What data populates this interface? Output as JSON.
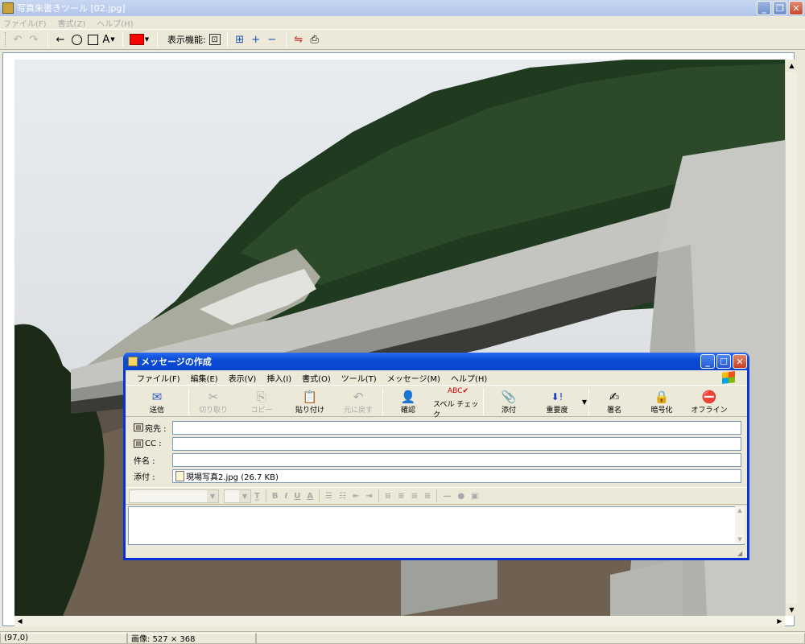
{
  "app": {
    "title": "写真朱書きツール [02.jpg]",
    "menu": [
      "ファイル(F)",
      "書式(Z)",
      "ヘルプ(H)"
    ],
    "toolbar": {
      "undo": "↶",
      "redo": "↷",
      "arrow": "←",
      "text_tool": "A",
      "color": "#ff0000",
      "display_label": "表示機能:",
      "fit_icon": "⊡",
      "zoom_fit": "⊞",
      "zoom_in": "+",
      "zoom_out": "−",
      "export_icon": "⇋",
      "print_icon": "⎙"
    }
  },
  "status": {
    "coords": "(97,0)",
    "image_size": "画像: 527 × 368"
  },
  "dialog": {
    "title": "メッセージの作成",
    "menu": [
      "ファイル(F)",
      "編集(E)",
      "表示(V)",
      "挿入(I)",
      "書式(O)",
      "ツール(T)",
      "メッセージ(M)",
      "ヘルプ(H)"
    ],
    "toolbar": [
      {
        "label": "送信",
        "icon": "✉",
        "enabled": true
      },
      {
        "label": "切り取り",
        "icon": "✂",
        "enabled": false
      },
      {
        "label": "コピー",
        "icon": "⎘",
        "enabled": false
      },
      {
        "label": "貼り付け",
        "icon": "📋",
        "enabled": true
      },
      {
        "label": "元に戻す",
        "icon": "↶",
        "enabled": false
      },
      {
        "label": "確認",
        "icon": "👤",
        "enabled": true
      },
      {
        "label": "スペル チェック",
        "icon": "ABC✔",
        "enabled": true
      },
      {
        "label": "添付",
        "icon": "📎",
        "enabled": true
      },
      {
        "label": "重要度",
        "icon": "⬇!",
        "enabled": true
      },
      {
        "label": "署名",
        "icon": "✍",
        "enabled": true
      },
      {
        "label": "暗号化",
        "icon": "🔒",
        "enabled": true
      },
      {
        "label": "オフライン",
        "icon": "⛔",
        "enabled": true
      }
    ],
    "fields": {
      "to_label": "宛先 :",
      "cc_label": "CC :",
      "subject_label": "件名 :",
      "attach_label": "添付 :",
      "to_value": "",
      "cc_value": "",
      "subject_value": "",
      "attachment": "現場写真2.jpg (26.7 KB)"
    },
    "format_bar": {
      "bold": "B",
      "italic": "I",
      "underline": "U",
      "font_color": "A"
    },
    "body": ""
  }
}
